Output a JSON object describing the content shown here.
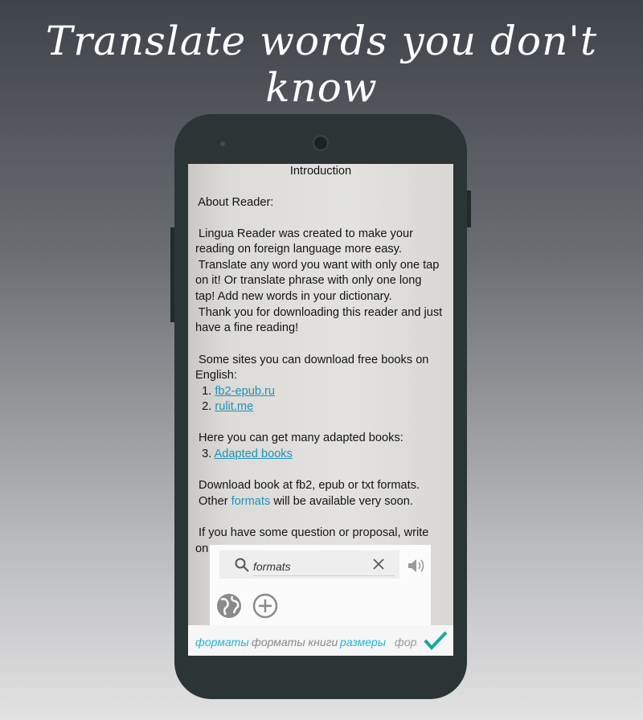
{
  "headline": "Translate words you don't know",
  "reader": {
    "title": "Introduction",
    "lines": [
      [
        {
          "text": " About Reader:"
        }
      ],
      [
        {
          "text": " Lingua Reader was created to make your"
        }
      ],
      [
        {
          "text": "reading on foreign language more easy."
        }
      ],
      [
        {
          "text": " Translate any word you want with only one tap"
        }
      ],
      [
        {
          "text": "on it! Or translate phrase with only one long"
        }
      ],
      [
        {
          "text": "tap! Add new words in your dictionary."
        }
      ],
      [
        {
          "text": " Thank you for downloading this reader and just"
        }
      ],
      [
        {
          "text": "have a fine reading!"
        }
      ],
      [
        {
          "text": " Some sites you can download free books on"
        }
      ],
      [
        {
          "text": "English:"
        }
      ],
      [
        {
          "text": "  1. "
        },
        {
          "text": "fb2-epub.ru",
          "link": true
        }
      ],
      [
        {
          "text": "  2. "
        },
        {
          "text": "rulit.me",
          "link": true
        }
      ],
      [
        {
          "text": " Here you can get many adapted books:"
        }
      ],
      [
        {
          "text": "  3. "
        },
        {
          "text": "Adapted books",
          "link": true
        }
      ],
      [
        {
          "text": " Download book at fb2, epub or txt formats."
        }
      ],
      [
        {
          "text": " Other "
        },
        {
          "text": "formats",
          "highlight": true
        },
        {
          "text": " will be available very soon."
        }
      ],
      [
        {
          "text": " If you have some question or proposal, write"
        }
      ],
      [
        {
          "text": "on"
        }
      ]
    ]
  },
  "popup": {
    "search_value": "formats",
    "icons": [
      "search-icon",
      "clear-icon",
      "speaker-icon",
      "globe-icon",
      "add-icon"
    ]
  },
  "suggestions": [
    {
      "text": "форматы",
      "color": "#1fb5d6"
    },
    {
      "text": "форматы книги",
      "color": "#888888"
    },
    {
      "text": "размеры",
      "color": "#1fb5d6"
    },
    {
      "text": "форі",
      "color": "#999999"
    }
  ],
  "colors": {
    "accent": "#1fb5d6",
    "check": "#1aa89a",
    "link": "#1f93b5"
  }
}
